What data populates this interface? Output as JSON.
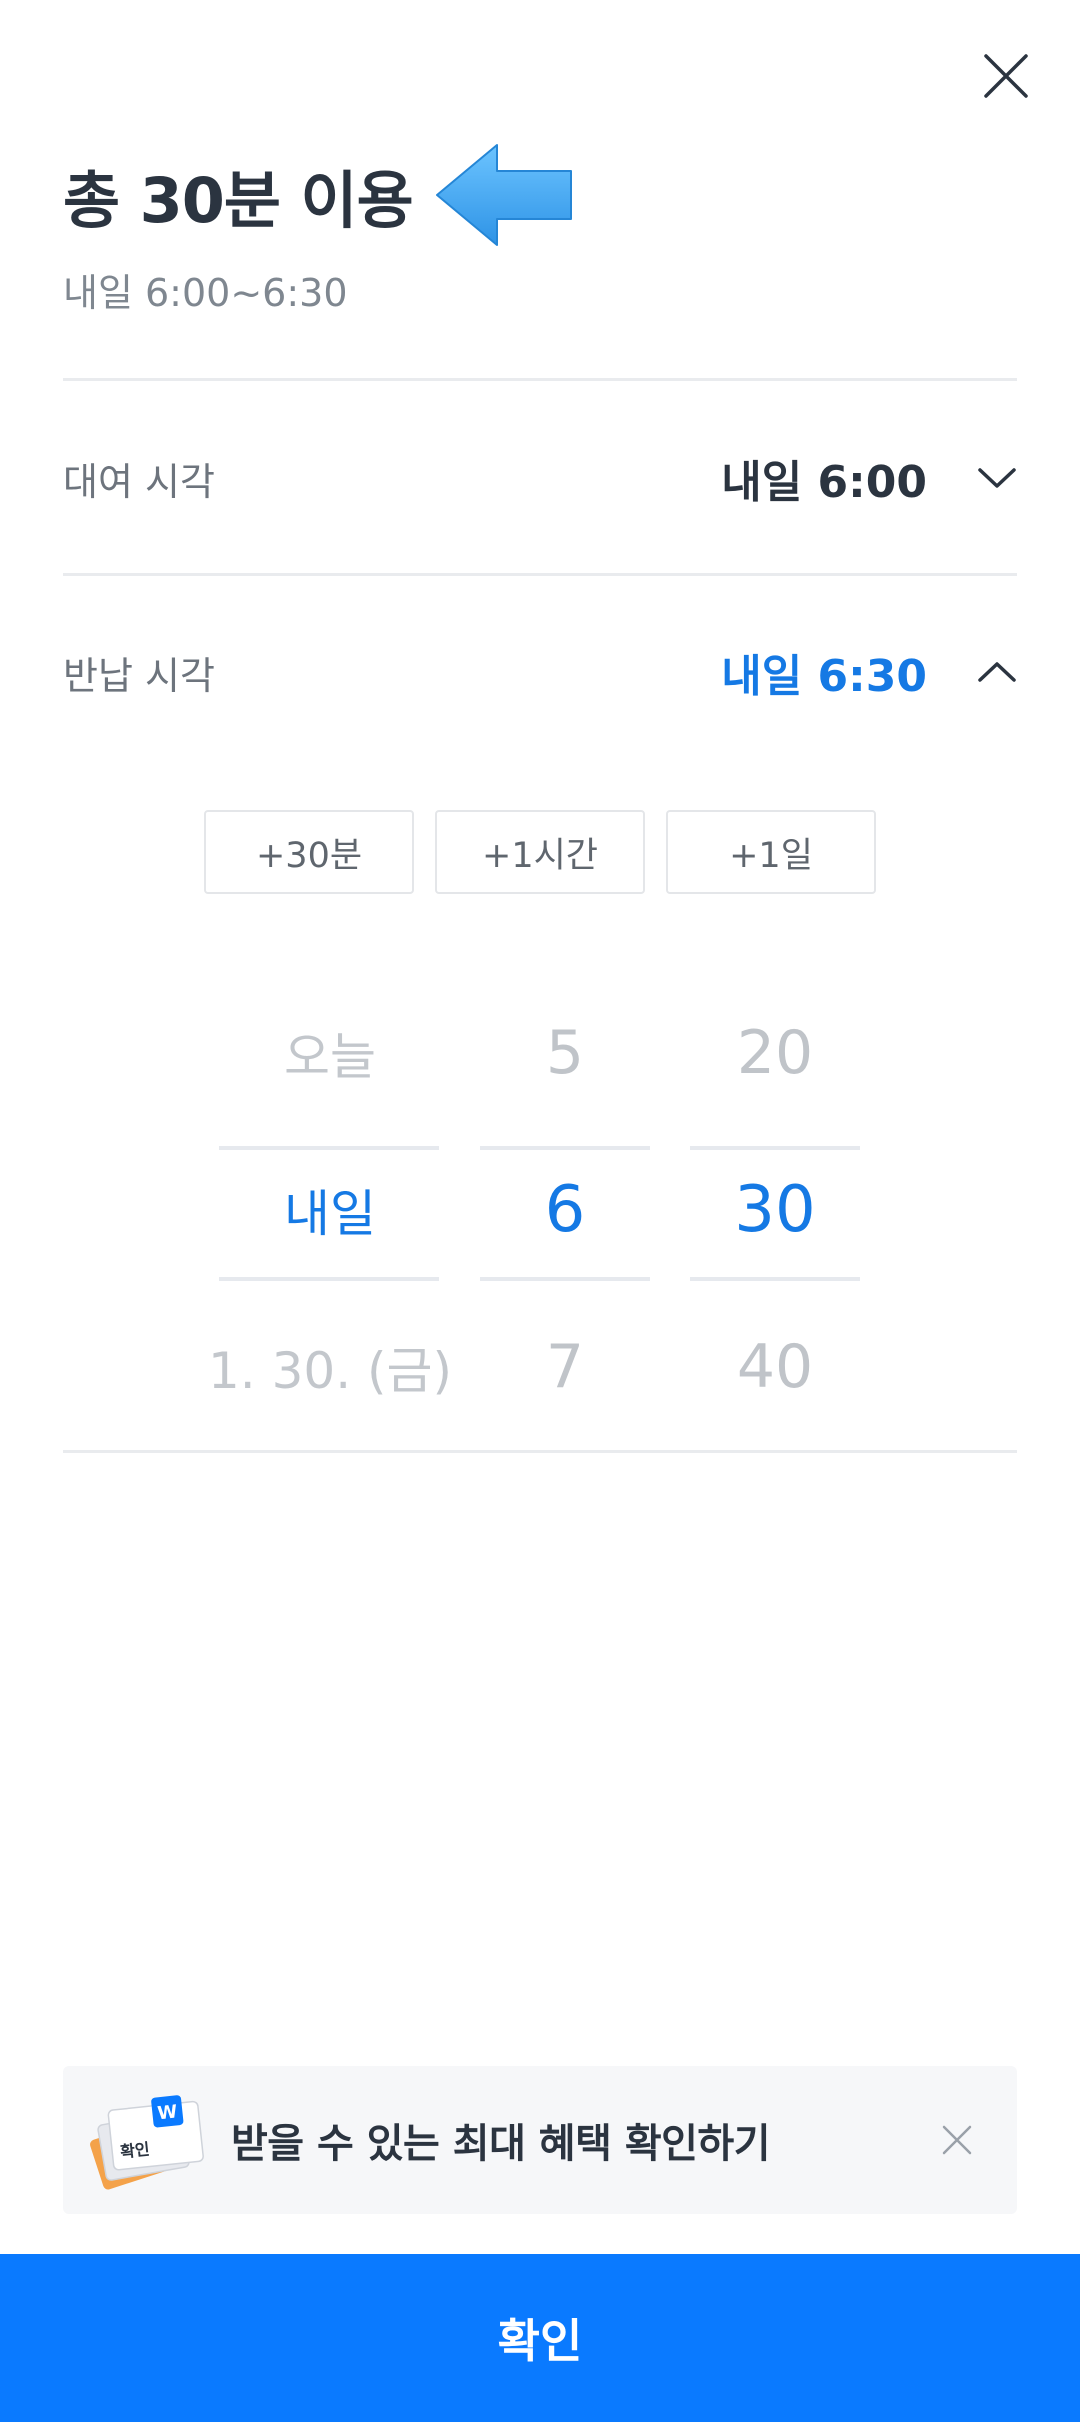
{
  "header": {
    "title": "총 30분 이용",
    "subtitle": "내일 6:00~6:30"
  },
  "rental": {
    "label": "대여 시각",
    "value": "내일 6:00"
  },
  "return": {
    "label": "반납 시각",
    "value": "내일 6:30"
  },
  "quick_buttons": [
    "+30분",
    "+1시간",
    "+1일"
  ],
  "picker": {
    "day": {
      "prev": "오늘",
      "selected": "내일",
      "next": "1. 30. (금)"
    },
    "hour": {
      "prev": "5",
      "selected": "6",
      "next": "7"
    },
    "minute": {
      "prev": "20",
      "selected": "30",
      "next": "40"
    }
  },
  "promo": {
    "text": "받을 수 있는 최대 혜택 확인하기",
    "card_text": "확인"
  },
  "confirm_label": "확인",
  "colors": {
    "accent": "#0a7aff",
    "selected_text": "#1579e4",
    "arrow": "#3fa9f5"
  }
}
